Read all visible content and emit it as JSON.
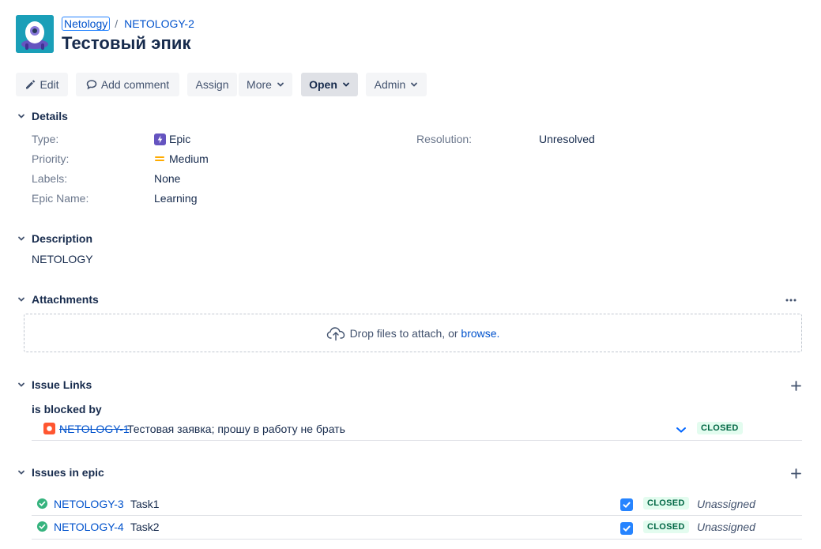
{
  "header": {
    "project_name": "Netology",
    "separator": "/",
    "issue_key": "NETOLOGY-2",
    "title": "Тестовый эпик"
  },
  "toolbar": {
    "edit_label": "Edit",
    "add_comment_label": "Add comment",
    "assign_label": "Assign",
    "more_label": "More",
    "open_label": "Open",
    "admin_label": "Admin"
  },
  "details": {
    "heading": "Details",
    "type_label": "Type:",
    "type_value": "Epic",
    "priority_label": "Priority:",
    "priority_value": "Medium",
    "labels_label": "Labels:",
    "labels_value": "None",
    "epic_name_label": "Epic Name:",
    "epic_name_value": "Learning",
    "resolution_label": "Resolution:",
    "resolution_value": "Unresolved"
  },
  "description": {
    "heading": "Description",
    "text": "NETOLOGY"
  },
  "attachments": {
    "heading": "Attachments",
    "drop_text": "Drop files to attach, or ",
    "browse_link": "browse."
  },
  "issue_links": {
    "heading": "Issue Links",
    "group_label": "is blocked by",
    "items": [
      {
        "key": "NETOLOGY-1",
        "summary": "Тестовая заявка; прошу в работу не брать",
        "status": "CLOSED"
      }
    ]
  },
  "issues_in_epic": {
    "heading": "Issues in epic",
    "items": [
      {
        "key": "NETOLOGY-3",
        "summary": "Task1",
        "status": "CLOSED",
        "assignee": "Unassigned"
      },
      {
        "key": "NETOLOGY-4",
        "summary": "Task2",
        "status": "CLOSED",
        "assignee": "Unassigned"
      }
    ]
  },
  "colors": {
    "link": "#0052cc",
    "epic": "#6554c0",
    "priority_medium": "#ffab00",
    "bug": "#ff5630",
    "done": "#36b37e"
  }
}
